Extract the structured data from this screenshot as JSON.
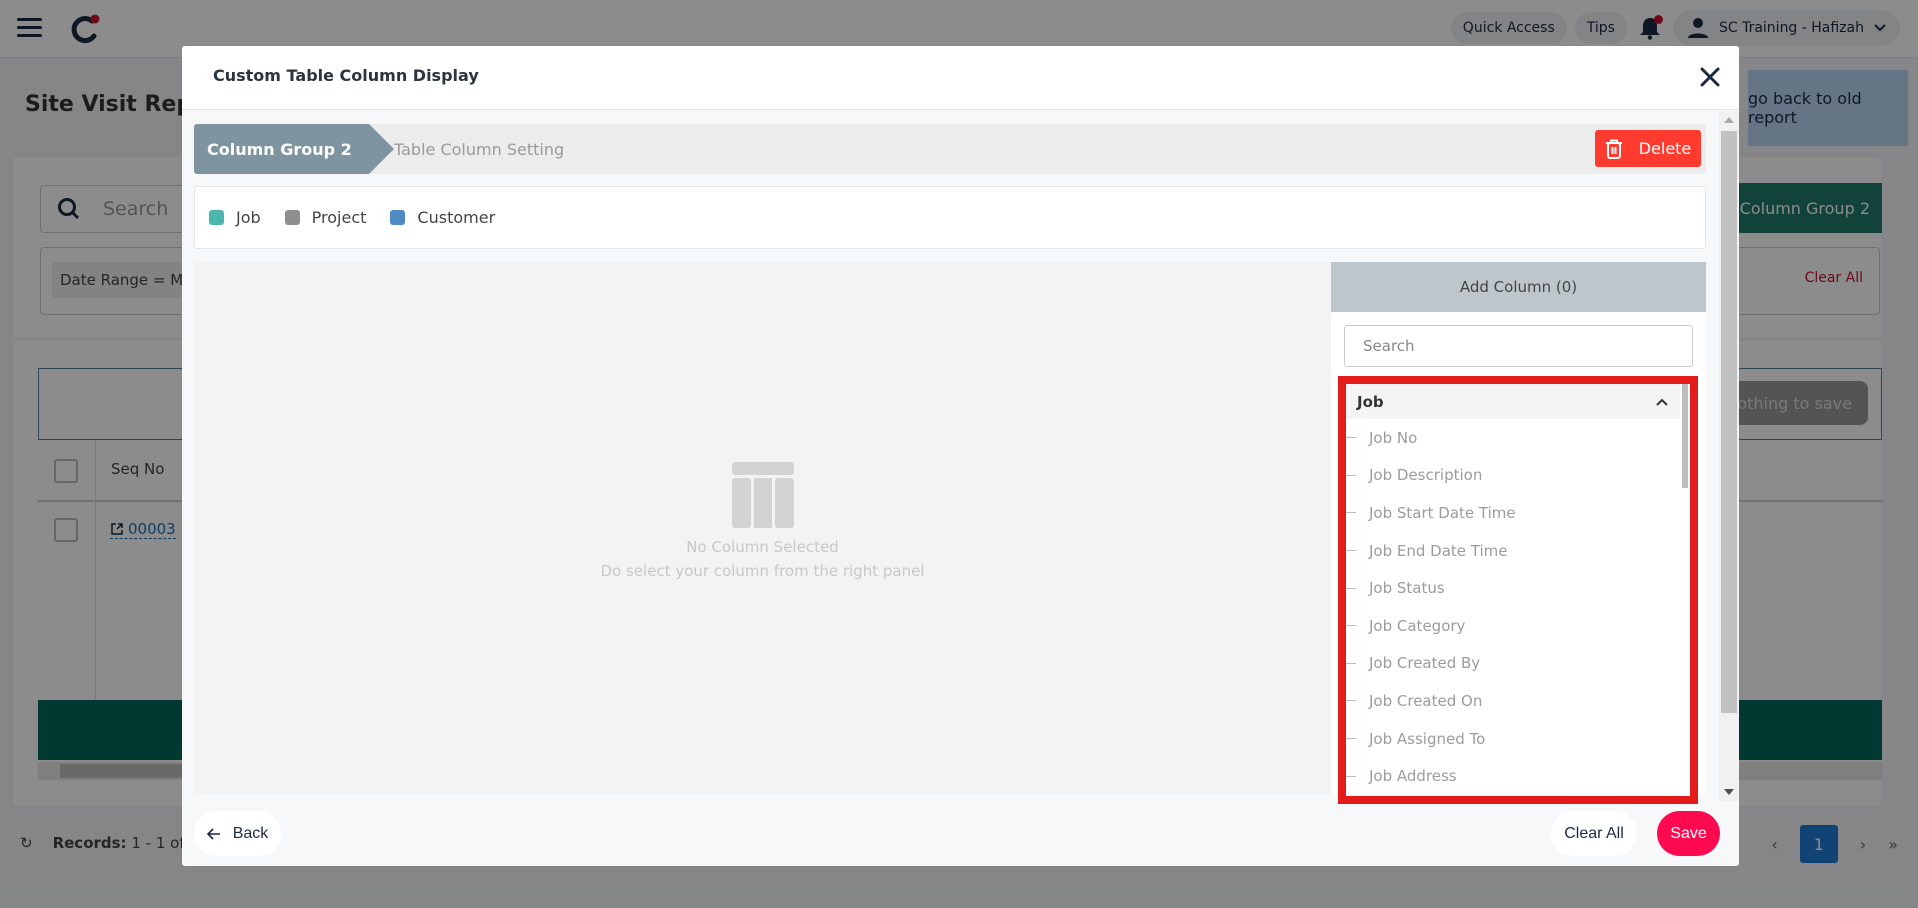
{
  "app": {
    "brand_color": "#1c2a44",
    "accent_color": "#c8102e"
  },
  "topbar": {
    "quick_access": "Quick Access",
    "tips": "Tips",
    "user_name": "SC Training - Hafizah"
  },
  "page": {
    "title": "Site Visit Report",
    "old_report_link": "go back to old report",
    "search_placeholder": "Search",
    "date_filter_chip": "Date Range = Mo",
    "column_group_button": "Column Group 2",
    "clear_all": "Clear All",
    "nothing_to_save": "Nothing to save",
    "table": {
      "headers": [
        "Seq No"
      ],
      "rows": [
        {
          "seq_no": "00003"
        }
      ]
    },
    "records_label": "Records:",
    "records_range": "1 - 1",
    "records_of": "of",
    "pagination": {
      "current_page": "1",
      "prev": "‹",
      "next": "›",
      "last": "»"
    }
  },
  "modal": {
    "title": "Custom Table Column Display",
    "steps": {
      "active": "Column Group 2",
      "next": "Table Column Setting"
    },
    "delete_label": "Delete",
    "legend": [
      {
        "label": "Job",
        "color": "#4db6ac"
      },
      {
        "label": "Project",
        "color": "#8e8e8e"
      },
      {
        "label": "Customer",
        "color": "#4e8ac4"
      }
    ],
    "empty_state": {
      "title": "No Column Selected",
      "subtitle": "Do select your column from the right panel"
    },
    "add_column": {
      "header": "Add Column (0)",
      "search_placeholder": "Search",
      "group_name": "Job",
      "items": [
        "Job No",
        "Job Description",
        "Job Start Date Time",
        "Job End Date Time",
        "Job Status",
        "Job Category",
        "Job Created By",
        "Job Created On",
        "Job Assigned To",
        "Job Address"
      ]
    },
    "footer": {
      "back": "Back",
      "clear_all": "Clear All",
      "save": "Save"
    }
  }
}
